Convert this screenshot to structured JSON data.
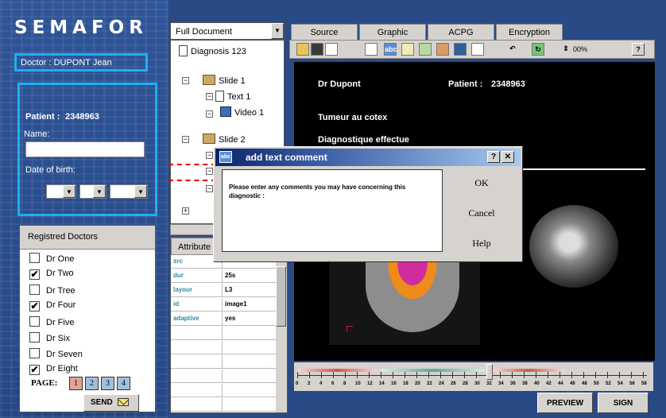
{
  "app_title": "SEMAFOR",
  "doctor": {
    "label": "Doctor : DUPONT Jean"
  },
  "patient": {
    "label": "Patient :",
    "id": "2348963",
    "name_label": "Name:",
    "name_value": "",
    "dob_label": "Date of birth:"
  },
  "doctors_panel": {
    "header": "Registred Doctors",
    "doctors": [
      {
        "name": "Dr One",
        "checked": false,
        "mark": ""
      },
      {
        "name": "Dr Two",
        "checked": true,
        "mark": "✔"
      },
      {
        "name": "Dr Tree",
        "checked": false,
        "mark": ""
      },
      {
        "name": "Dr Four",
        "checked": true,
        "mark": "✔"
      },
      {
        "name": "Dr Five",
        "checked": false,
        "mark": ""
      },
      {
        "name": "Dr Six",
        "checked": false,
        "mark": ""
      },
      {
        "name": "Dr Seven",
        "checked": false,
        "mark": ""
      },
      {
        "name": "Dr Eight",
        "checked": true,
        "mark": "✔"
      }
    ],
    "page_label": "PAGE:",
    "pages": [
      "1",
      "2",
      "3",
      "4"
    ],
    "send_label": "SEND"
  },
  "tree": {
    "combo_value": "Full Document",
    "nodes": [
      "Diagnosis 123",
      "Slide 1",
      "Text 1",
      "Video 1",
      "Slide 2"
    ]
  },
  "attributes": {
    "tab_label": "Attribute",
    "rows": [
      {
        "key": "src",
        "value": ""
      },
      {
        "key": "dur",
        "value": "25s"
      },
      {
        "key": "layour",
        "value": "L3"
      },
      {
        "key": "id",
        "value": "image1"
      },
      {
        "key": "adaptive",
        "value": "yes"
      }
    ]
  },
  "tabs": [
    "Source",
    "Graphic",
    "ACPG",
    "Encryption"
  ],
  "toolbar": {
    "zoom": "00%",
    "help": "?"
  },
  "viewer": {
    "doctor": "Dr Dupont",
    "patient_label": "Patient :",
    "patient_id": "2348963",
    "line1": "Tumeur  au cotex",
    "line2": "Diagnostique effectue"
  },
  "timeline": {
    "ticks": [
      "0",
      "2",
      "4",
      "6",
      "8",
      "10",
      "12",
      "14",
      "16",
      "18",
      "20",
      "22",
      "24",
      "26",
      "28",
      "30",
      "32",
      "34",
      "36",
      "38",
      "40",
      "42",
      "44",
      "46",
      "48",
      "50",
      "52",
      "54",
      "56",
      "58"
    ]
  },
  "buttons": {
    "preview": "PREVIEW",
    "sign": "SIGN"
  },
  "dialog": {
    "title": "add text comment",
    "help_btn": "?",
    "close_btn": "✕",
    "message": "Please enter any comments you may have concerning this diagnostic :",
    "ok": "OK",
    "cancel": "Cancel",
    "help": "Help"
  },
  "colors": {
    "accent_cyan": "#1eb0f0",
    "panel_blue": "#2f5598",
    "title_bar": "#0a246a",
    "dashed_line": "#dd0000"
  }
}
